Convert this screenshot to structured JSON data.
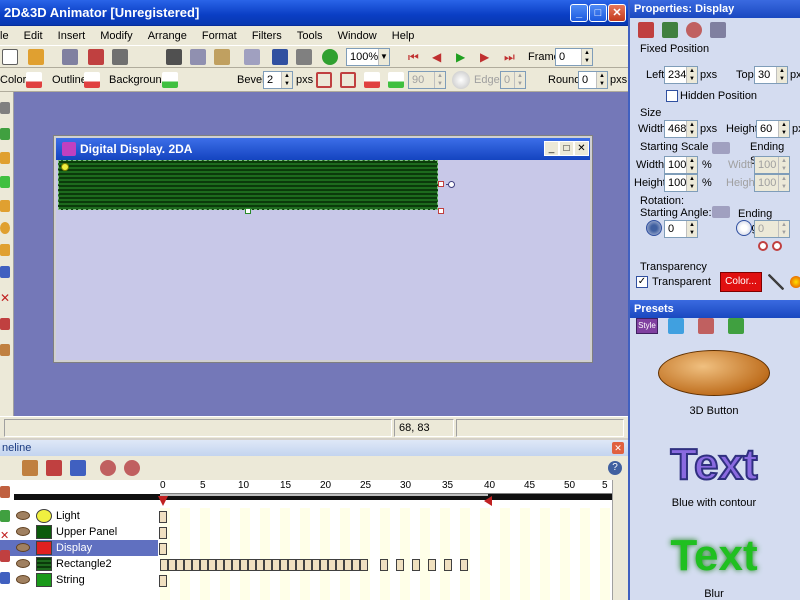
{
  "app": {
    "title": "2D&3D Animator [Unregistered]",
    "win_minimize": "_",
    "win_maximize": "□",
    "win_close": "✕"
  },
  "menu": [
    "le",
    "Edit",
    "Insert",
    "Modify",
    "Arrange",
    "Format",
    "Filters",
    "Tools",
    "Window",
    "Help"
  ],
  "toolbar": {
    "zoom_value": "100%",
    "frame_label": "Frame:",
    "frame_value": "0"
  },
  "format_bar": {
    "color_label": "Color:",
    "outline_label": "Outline:",
    "background_label": "Background:",
    "bevel_label": "Bevel:",
    "bevel_value": "2",
    "bevel_unit": "pxs",
    "bevel2_value": "90",
    "edge_label": "Edge:",
    "edge_value": "0",
    "round_label": "Round:",
    "round_value": "0",
    "round_unit": "pxs"
  },
  "document": {
    "title": "Digital Display. 2DA",
    "btn_min": "_",
    "btn_max": "□",
    "btn_close": "✕"
  },
  "status": {
    "coords": "68, 83"
  },
  "timeline": {
    "title": "neline",
    "help_icon": "?",
    "ruler_labels": [
      "0",
      "5",
      "10",
      "15",
      "20",
      "25",
      "30",
      "35",
      "40",
      "45",
      "50",
      "5"
    ],
    "layers": [
      {
        "name": "Light",
        "color": "#f0f040",
        "selected": false
      },
      {
        "name": "Upper Panel",
        "color": "#0b5a0b",
        "selected": false
      },
      {
        "name": "Display",
        "color": "#e02020",
        "selected": true
      },
      {
        "name": "Rectangle2",
        "color": "#1a7a1a",
        "selected": false
      },
      {
        "name": "String",
        "color": "#1a9a1a",
        "selected": false
      }
    ]
  },
  "properties": {
    "header": "Properties: Display",
    "fixed_position": "Fixed Position",
    "left_label": "Left:",
    "left_value": "234",
    "left_unit": "pxs",
    "top_label": "Top:",
    "top_value": "30",
    "top_unit": "pxs",
    "hidden_position": "Hidden Position",
    "size": "Size",
    "width_label": "Width:",
    "width_value": "468",
    "width_unit": "pxs",
    "height_label": "Height:",
    "height_value": "60",
    "height_unit": "pxs",
    "starting_scale": "Starting Scale",
    "ending_scale": "Ending Scale",
    "ss_width_label": "Width:",
    "ss_width_value": "100",
    "ss_height_label": "Height:",
    "ss_height_value": "100",
    "percent": "%",
    "es_width_label": "Width:",
    "es_width_value": "100",
    "es_height_label": "Height:",
    "es_height_value": "100",
    "rotation": "Rotation:",
    "starting_angle": "Starting Angle:",
    "starting_angle_value": "0",
    "ending_angle": "Ending Angle:",
    "ending_angle_value": "0",
    "transparency": "Transparency",
    "transparent_label": "Transparent",
    "transparent_checked": "✓",
    "color_button": "Color..."
  },
  "presets": {
    "header": "Presets",
    "style_tab": "Style",
    "items": [
      {
        "label": "3D Button"
      },
      {
        "label": "Blue with contour",
        "text": "Text"
      },
      {
        "label": "Blur",
        "text": "Text"
      }
    ]
  }
}
